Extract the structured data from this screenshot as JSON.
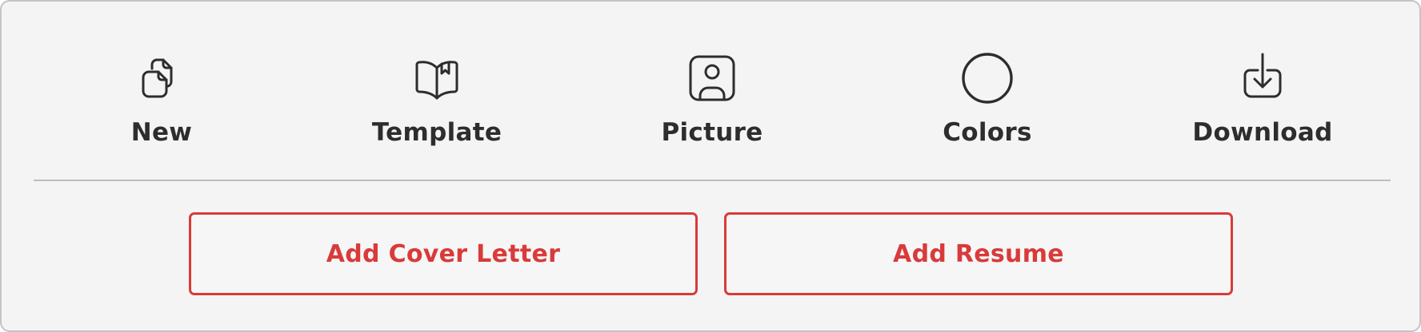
{
  "toolbar": {
    "items": [
      {
        "label": "New",
        "icon": "new-document-icon"
      },
      {
        "label": "Template",
        "icon": "book-bookmark-icon"
      },
      {
        "label": "Picture",
        "icon": "user-portrait-icon"
      },
      {
        "label": "Colors",
        "icon": "circle-icon"
      },
      {
        "label": "Download",
        "icon": "download-icon"
      }
    ]
  },
  "actions": {
    "cover_letter_label": "Add Cover Letter",
    "resume_label": "Add Resume"
  },
  "colors": {
    "background": "#f4f4f4",
    "text": "#2d2d2d",
    "accent": "#d93a3a",
    "divider": "#bdbdbd"
  }
}
